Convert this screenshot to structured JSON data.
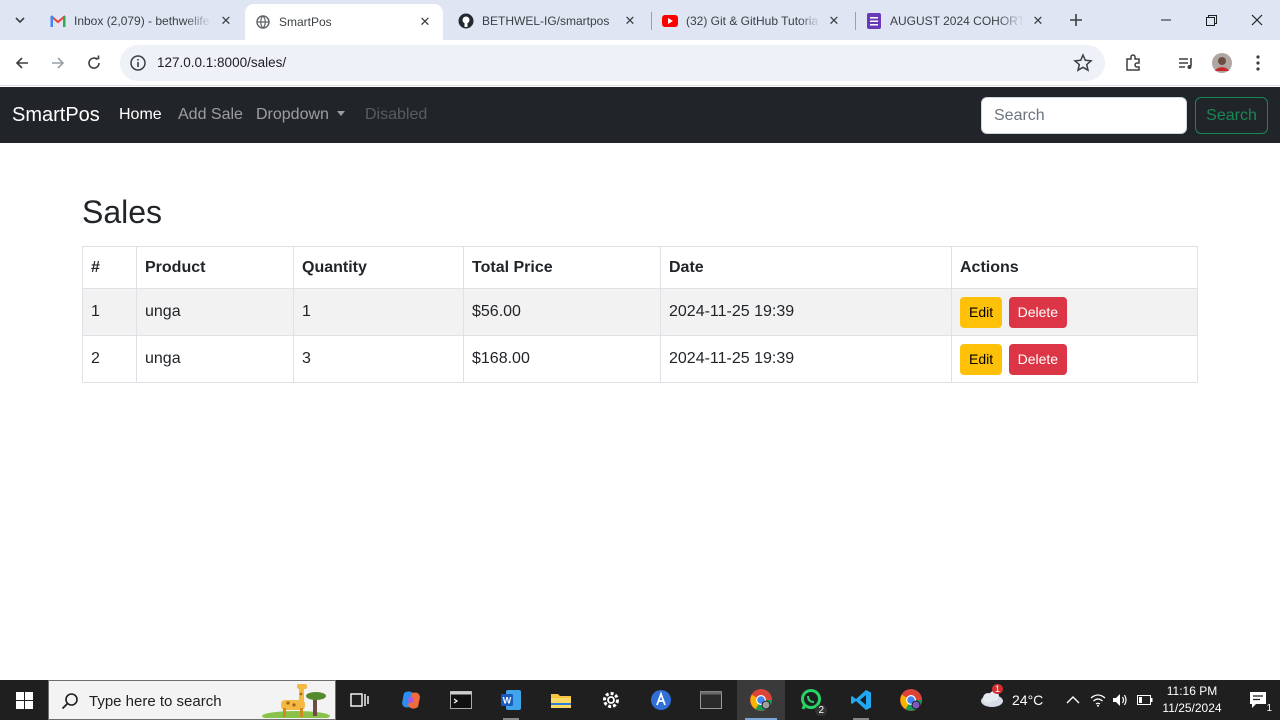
{
  "browser": {
    "tabs": [
      {
        "title": "Inbox (2,079) - bethwelife",
        "icon": "gmail-icon"
      },
      {
        "title": "SmartPos",
        "icon": "globe-icon",
        "active": true
      },
      {
        "title": "BETHWEL-IG/smartpos",
        "icon": "github-icon"
      },
      {
        "title": "(32) Git & GitHub Tutoria",
        "icon": "youtube-icon"
      },
      {
        "title": "AUGUST 2024 COHORT",
        "icon": "forms-icon"
      }
    ],
    "url": "127.0.0.1:8000/sales/"
  },
  "navbar": {
    "brand": "SmartPos",
    "links": {
      "home": "Home",
      "add_sale": "Add Sale",
      "dropdown": "Dropdown",
      "disabled": "Disabled"
    },
    "search_placeholder": "Search",
    "search_button": "Search"
  },
  "main": {
    "heading": "Sales",
    "table": {
      "headers": [
        "#",
        "Product",
        "Quantity",
        "Total Price",
        "Date",
        "Actions"
      ],
      "rows": [
        {
          "id": "1",
          "product": "unga",
          "quantity": "1",
          "total": "$56.00",
          "date": "2024-11-25 19:39"
        },
        {
          "id": "2",
          "product": "unga",
          "quantity": "3",
          "total": "$168.00",
          "date": "2024-11-25 19:39"
        }
      ],
      "edit_label": "Edit",
      "delete_label": "Delete"
    }
  },
  "taskbar": {
    "search_placeholder": "Type here to search",
    "whatsapp_badge": "2",
    "weather": "24°C",
    "weather_alert": "1",
    "time": "11:16 PM",
    "date": "11/25/2024",
    "notification_count": "1"
  },
  "colors": {
    "navbar_bg": "#212529",
    "success": "#198754",
    "warning": "#ffc107",
    "danger": "#dc3545"
  }
}
